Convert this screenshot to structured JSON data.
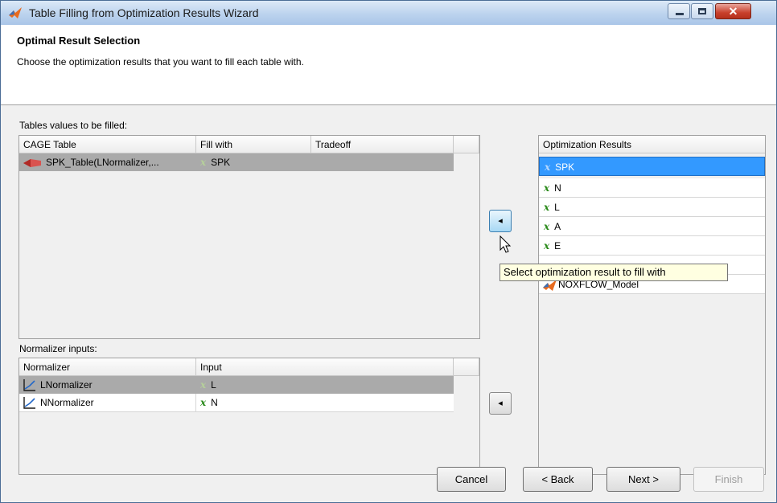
{
  "window": {
    "title": "Table Filling from Optimization Results Wizard",
    "close_glyph": "✕"
  },
  "header": {
    "title": "Optimal Result Selection",
    "subtitle": "Choose the optimization results that you want to fill each table with."
  },
  "tables_section": {
    "label": "Tables values to be filled:",
    "columns": [
      "CAGE Table",
      "Fill with",
      "Tradeoff"
    ],
    "rows": [
      {
        "table": "SPK_Table(LNormalizer,...",
        "fill_with": "SPK",
        "tradeoff": ""
      }
    ]
  },
  "normalizer_section": {
    "label": "Normalizer inputs:",
    "columns": [
      "Normalizer",
      "Input"
    ],
    "rows": [
      {
        "normalizer": "LNormalizer",
        "input": "L"
      },
      {
        "normalizer": "NNormalizer",
        "input": "N"
      }
    ]
  },
  "optimization_results": {
    "header": "Optimization Results",
    "items": [
      {
        "label": "SPK",
        "icon": "x-variable-icon"
      },
      {
        "label": "N",
        "icon": "x-variable-icon"
      },
      {
        "label": "L",
        "icon": "x-variable-icon"
      },
      {
        "label": "A",
        "icon": "x-variable-icon"
      },
      {
        "label": "E",
        "icon": "x-variable-icon"
      },
      {
        "label": "NOXFLOW_Model",
        "icon": "matlab-model-icon"
      }
    ]
  },
  "x_glyph": "x",
  "arrow_glyph": "◂",
  "tooltip": "Select optimization result to fill with",
  "buttons": {
    "cancel": "Cancel",
    "back": "< Back",
    "next": "Next >",
    "finish": "Finish"
  },
  "colors": {
    "selection_blue": "#3399ff",
    "selected_row_gray": "#aaaaaa",
    "variable_green": "#2a8a1a"
  }
}
